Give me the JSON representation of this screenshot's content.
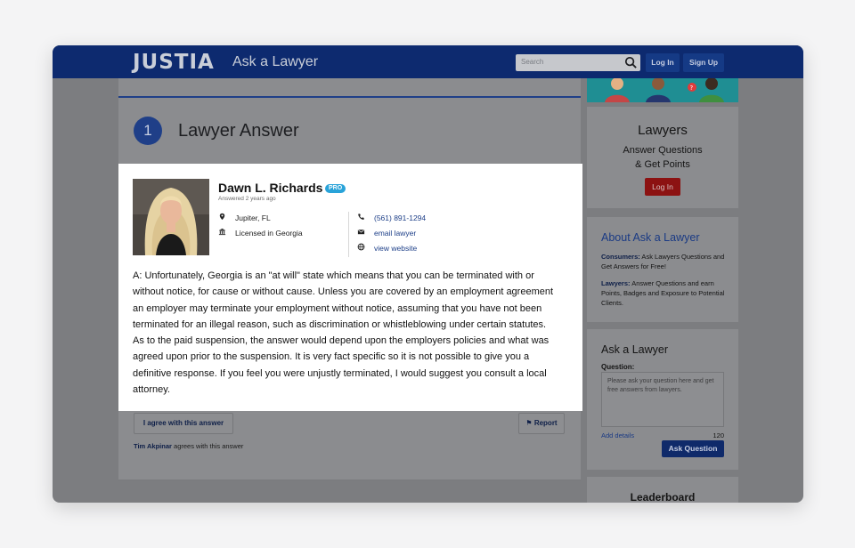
{
  "header": {
    "logo": "JUSTIA",
    "logo_sub": "Ask a Lawyer",
    "search_placeholder": "Search",
    "login_label": "Log In",
    "signup_label": "Sign Up"
  },
  "answer_section": {
    "number": "1",
    "heading": "Lawyer Answer"
  },
  "lawyer": {
    "name": "Dawn L. Richards",
    "badge": "PRO",
    "answered": "Answered 2 years ago",
    "location": "Jupiter, FL",
    "license": "Licensed in Georgia",
    "phone": "(561) 891-1294",
    "email_label": "email lawyer",
    "website_label": "view website"
  },
  "answer_lines": [
    "A: Unfortunately, Georgia is an \"at will\" state which means that you can be terminated with or",
    "without notice, for cause or without cause. Unless you are covered by an employment agreement",
    "an employer may terminate your employment without notice, assuming that you have not been",
    "terminated for an illegal reason, such as discrimination or whistleblowing under certain statutes.",
    "As to the paid suspension, the answer would depend upon the employers policies and what was",
    "agreed upon prior to the suspension. It is very fact specific so it is not possible to give you a",
    "definitive response. If you feel you were unjustly terminated, I would suggest you consult a local",
    "attorney."
  ],
  "actions": {
    "agree_label": "I agree with this answer",
    "report_label": "Report",
    "agree_user": "Tim Akpinar",
    "agree_suffix": " agrees with this answer"
  },
  "sidebar": {
    "lawyers_title": "Lawyers",
    "lawyers_line1": "Answer Questions",
    "lawyers_line2": "& Get Points",
    "lawyers_login": "Log In",
    "about_title": "About Ask a Lawyer",
    "consumers_label": "Consumers:",
    "consumers_text": " Ask Lawyers Questions and Get Answers for Free!",
    "lawyers_label": "Lawyers:",
    "lawyers_text": " Answer Questions and earn Points, Badges and Exposure to Potential Clients.",
    "ask_title": "Ask a Lawyer",
    "question_label": "Question:",
    "question_placeholder": "Please ask your question here and get free answers from lawyers.",
    "add_details": "Add details",
    "char_count": "120",
    "ask_button": "Ask Question",
    "leaderboard": "Leaderboard"
  },
  "colors": {
    "header_bg": "#0d2a6f",
    "accent": "#1f3f88",
    "pro_badge": "#29a3d9",
    "login_red": "#8c1212"
  }
}
